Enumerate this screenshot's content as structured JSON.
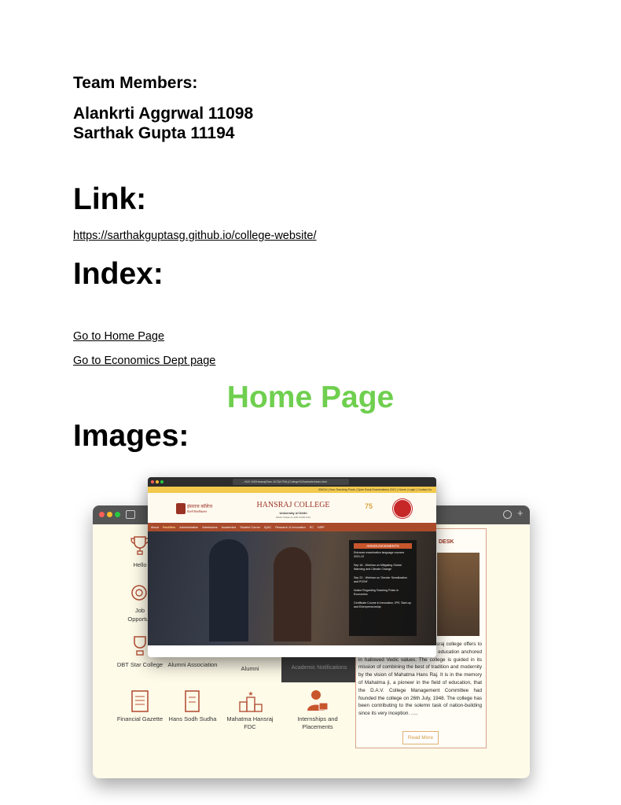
{
  "team": {
    "heading": "Team Members:",
    "members": [
      "Alankrti Aggrwal 11098",
      "Sarthak Gupta 11194"
    ]
  },
  "link": {
    "heading": "Link:",
    "url": "https://sarthakguptasg.github.io/college-website/"
  },
  "index": {
    "heading": "Index:",
    "items": [
      "Go to Home Page",
      "Go to Economics Dept page"
    ]
  },
  "section_title": "Home Page",
  "images_heading": "Images:",
  "screenshot": {
    "browser_url": "...%20-%20Hansraj/Sem-3/CS(HTML)/College%20website/index.html",
    "top_bar_text": "IGNOU | Non-Teaching Posts | Open Book Examinations 2021 | Home | Login | Contact Us",
    "college_name": "HANSRAJ COLLEGE",
    "university": "University of Delhi",
    "naac": "NAAC Grade A+ with CGPA 3.62",
    "logo_hindi": "हंसराज कॉलेज",
    "logo_hindi_sub": "दिल्ली विश्वविद्यालय",
    "nav_items": [
      "About",
      "Facilities",
      "Administration",
      "Admissions",
      "Academics",
      "Student Corner",
      "IQAC",
      "Research & Innovation",
      "EC",
      "NIRF"
    ],
    "announcements_title": "ANNOUNCEMENTS",
    "announcements": [
      "Entrance examination language courses 2021-22",
      "Sep 18 - Webinar on Mitigating Global Warming and Climate Change",
      "Sep 22 - Webinar on 'Gender Sensitization and POSH'",
      "Notice Regarding Teaching Posts in Economics",
      "Certificate Course in Innovation, IPR, Start-up and Entrepreneurship"
    ],
    "desk_title": "DESK",
    "desk_text": "nsraj College! As a education, Hansraj college offers to students a unique blend of modern education anchored in hallowed Vedic values. The college is guided in its mission of combining the best of tradition and modernity by the vision of Mahatma Hans Raj. It is in the memory of Mahatma ji, a pioneer in the field of education, that the D.A.V. College Management Committee had founded the college on 26th July, 1948. The college has been contributing to the solemn task of nation-building since its very inception. .....",
    "read_more": "Read More",
    "icon_labels": {
      "hello": "Hello",
      "job": "Job",
      "opportunities": "Opportun",
      "dbt": "DBT Star College",
      "alumni_association": "Alumni Association",
      "alumni": "Alumni",
      "academic_notifications": "Academic Notifications",
      "financial": "Financial Gazette",
      "hans_sodh": "Hans Sodh Sudha",
      "fdc": "Mahatma Hansraj FDC",
      "internships": "Internships and Placements"
    }
  },
  "colors": {
    "heading_green": "#6fcf4f",
    "brand_maroon": "#9a3324",
    "accent_orange": "#c8562c"
  }
}
